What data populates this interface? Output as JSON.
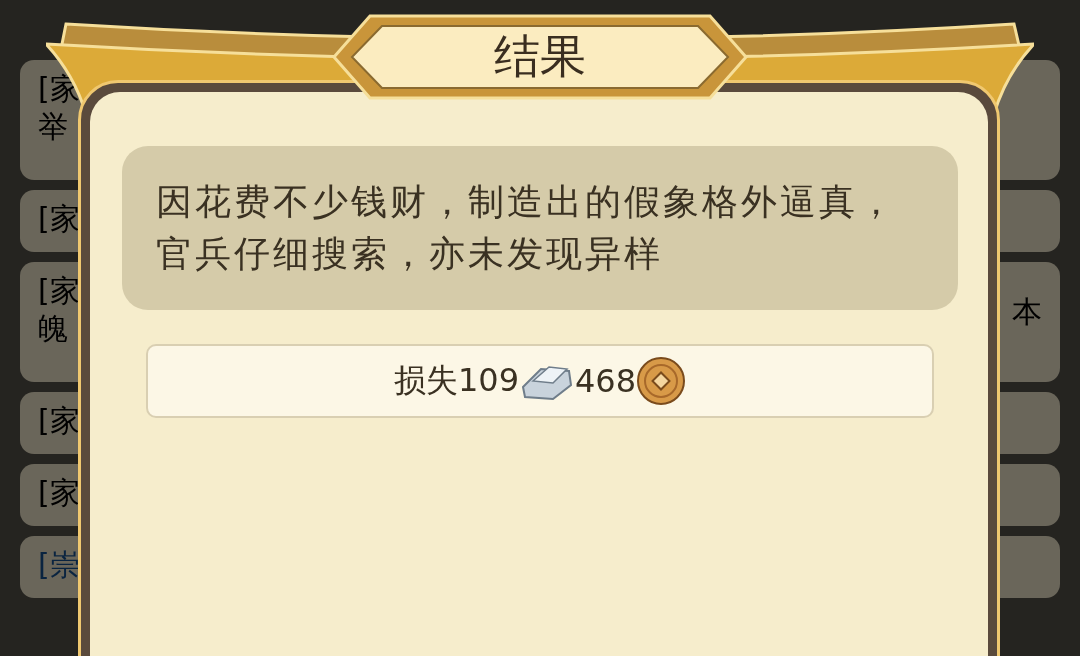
{
  "background_list": [
    {
      "kind": "text",
      "lines": [
        "[家",
        "举"
      ]
    },
    {
      "kind": "text",
      "lines": [
        "[家"
      ]
    },
    {
      "kind": "text",
      "lines": [
        "[家",
        "魄"
      ],
      "right": "本"
    },
    {
      "kind": "text",
      "lines": [
        "[家"
      ]
    },
    {
      "kind": "text",
      "lines": [
        "[家"
      ]
    },
    {
      "kind": "link",
      "lines": [
        "[崇"
      ]
    }
  ],
  "dialog": {
    "title": "结果",
    "message": "因花费不少钱财，制造出的假象格外逼真，官兵仔细搜索，亦未发现异样",
    "loss": {
      "silver_text": "损失109",
      "copper_text": "468"
    }
  }
}
